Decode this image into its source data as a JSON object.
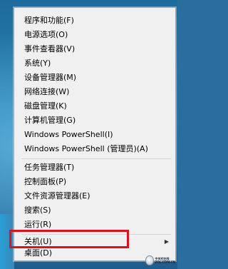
{
  "menu": {
    "group1": [
      "程序和功能(F)",
      "电源选项(O)",
      "事件查看器(V)",
      "系统(Y)",
      "设备管理器(M)",
      "网络连接(W)",
      "磁盘管理(K)",
      "计算机管理(G)",
      "Windows PowerShell(I)",
      "Windows PowerShell (管理员)(A)"
    ],
    "group2": [
      "任务管理器(T)",
      "控制面板(P)",
      "文件资源管理器(E)",
      "搜索(S)",
      "运行(R)"
    ],
    "shutdown": "关机(U)",
    "desktop": "桌面(D)"
  },
  "watermark": {
    "line1": "中关村在线",
    "line2": "ZOL.COM.CN"
  },
  "colors": {
    "highlight_border": "#d9141e",
    "menu_background": "#f0f0f0"
  }
}
